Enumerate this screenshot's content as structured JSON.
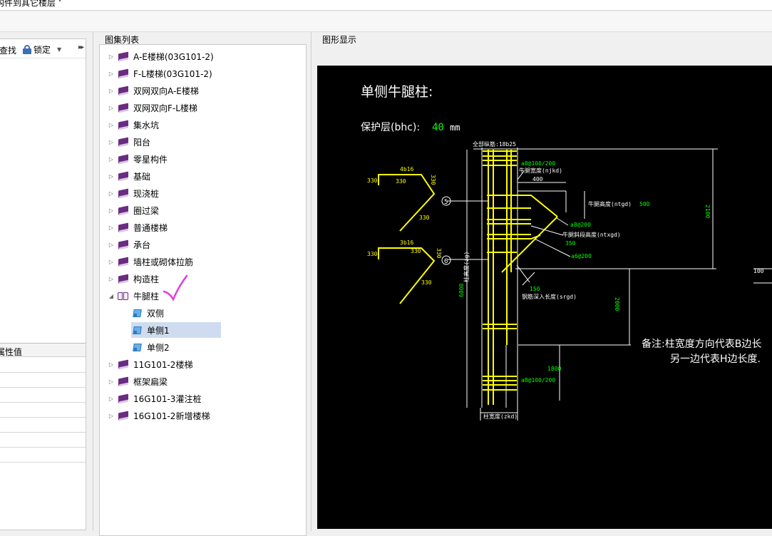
{
  "window": {
    "top_title": "构件到其它楼层"
  },
  "left_panel": {
    "find_label": "查找",
    "lock_label": "锁定",
    "more_glyph": "▸▸",
    "property_header": "属性值"
  },
  "atlas": {
    "title": "图集列表",
    "items": [
      {
        "label": "A-E楼梯(03G101-2)"
      },
      {
        "label": "F-L楼梯(03G101-2)"
      },
      {
        "label": "双网双向A-E楼梯"
      },
      {
        "label": "双网双向F-L楼梯"
      },
      {
        "label": "集水坑"
      },
      {
        "label": "阳台"
      },
      {
        "label": "零星构件"
      },
      {
        "label": "基础"
      },
      {
        "label": "现浇桩"
      },
      {
        "label": "圈过梁"
      },
      {
        "label": "普通楼梯"
      },
      {
        "label": "承台"
      },
      {
        "label": "墙柱或砌体拉筋"
      },
      {
        "label": "构造柱"
      },
      {
        "label": "牛腿柱"
      },
      {
        "label": "双侧"
      },
      {
        "label": "单侧1"
      },
      {
        "label": "单侧2"
      },
      {
        "label": "11G101-2楼梯"
      },
      {
        "label": "框架扁梁"
      },
      {
        "label": "16G101-3灌注桩"
      },
      {
        "label": "16G101-2新增楼梯"
      }
    ],
    "selected": "单侧1"
  },
  "graphic": {
    "title": "图形显示",
    "drawing": {
      "heading": "单侧牛腿柱:",
      "cover_label": "保护层(bhc):",
      "cover_value": "40",
      "cover_unit": "mm",
      "all_rebar": "全部纵筋:18b25",
      "stirrup_top": "a8@100/200",
      "corbel_width": "牛腿宽度(njkd)",
      "corbel_width_val": "400",
      "corbel_height": "牛腿高度(ntgd)",
      "corbel_height_val": "500",
      "slope_height": "牛腿斜段高度(ntxgd)",
      "slope_height_val": "350",
      "stir_a": "a8@200",
      "stir_b": "a6@200",
      "anchor": "钢筋深入长度(srgd)",
      "anchor_val": "150",
      "dim_2100": "2100",
      "dim_100": "100",
      "dim_2000": "2000",
      "dim_1800": "1800",
      "dim_6000": "6000",
      "col_height": "柱高度(zg)",
      "stirrup_bottom": "a8@100/200",
      "col_width": "柱宽度(zkd)",
      "bar1_top": "4b16",
      "bar1_l": "330",
      "bar1_mid": "330",
      "bar1_r": "330",
      "bar1_diag": "330",
      "bar2_top": "3b16",
      "bar2_l": "330",
      "bar2_mid": "330",
      "bar2_r": "330",
      "bar2_diag": "330",
      "marker5": "5",
      "marker6": "6",
      "note1": "备注:柱宽度方向代表B边长",
      "note2": "另一边代表H边长度."
    }
  },
  "colors": {
    "bg": "#f0f0f0",
    "drawing_bg": "#000000",
    "rebar": "#ffff00",
    "dim": "#00ff00",
    "selection": "#cfdcef",
    "annotation": "#e33ce0"
  }
}
